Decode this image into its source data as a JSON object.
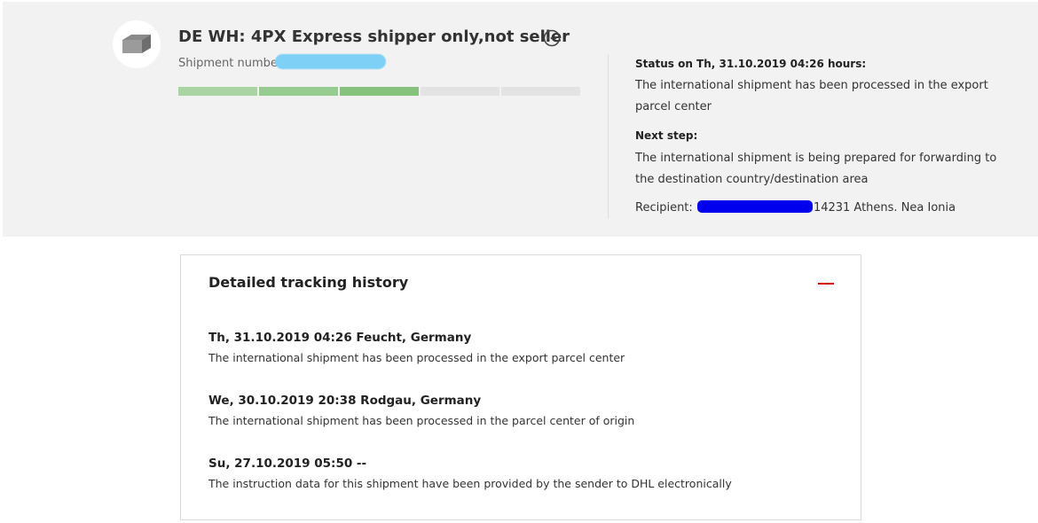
{
  "shipment": {
    "title": "DE WH: 4PX Express shipper only,not seller",
    "number_label": "Shipment number",
    "progress": {
      "total_segments": 5,
      "completed_segments": 3
    },
    "more_icon": "more-options-icon",
    "package_icon": "package-icon"
  },
  "status": {
    "heading": "Status on Th, 31.10.2019 04:26 hours:",
    "text": "The international shipment has been processed in the export parcel center",
    "next_heading": "Next step:",
    "next_text": "The international shipment is being prepared for forwarding to the destination country/destination area",
    "recipient_label": "Recipient:",
    "recipient_address": "14231 Athens. Nea Ionia"
  },
  "history": {
    "title": "Detailed tracking history",
    "collapse_icon": "minus-icon",
    "events": [
      {
        "heading": "Th, 31.10.2019 04:26 Feucht, Germany",
        "description": "The international shipment has been processed in the export parcel center"
      },
      {
        "heading": "We, 30.10.2019 20:38 Rodgau, Germany",
        "description": "The international shipment has been processed in the parcel center of origin"
      },
      {
        "heading": "Su, 27.10.2019 05:50 --",
        "description": "The instruction data for this shipment have been provided by the sender to DHL electronically"
      }
    ]
  },
  "colors": {
    "progress_done": [
      "#a8d5a2",
      "#97cc90",
      "#86c27e"
    ],
    "progress_todo": "#e3e3e3",
    "accent_red": "#d40511",
    "redaction_light": "#7fd0f7",
    "redaction_dark": "#0000ee"
  }
}
